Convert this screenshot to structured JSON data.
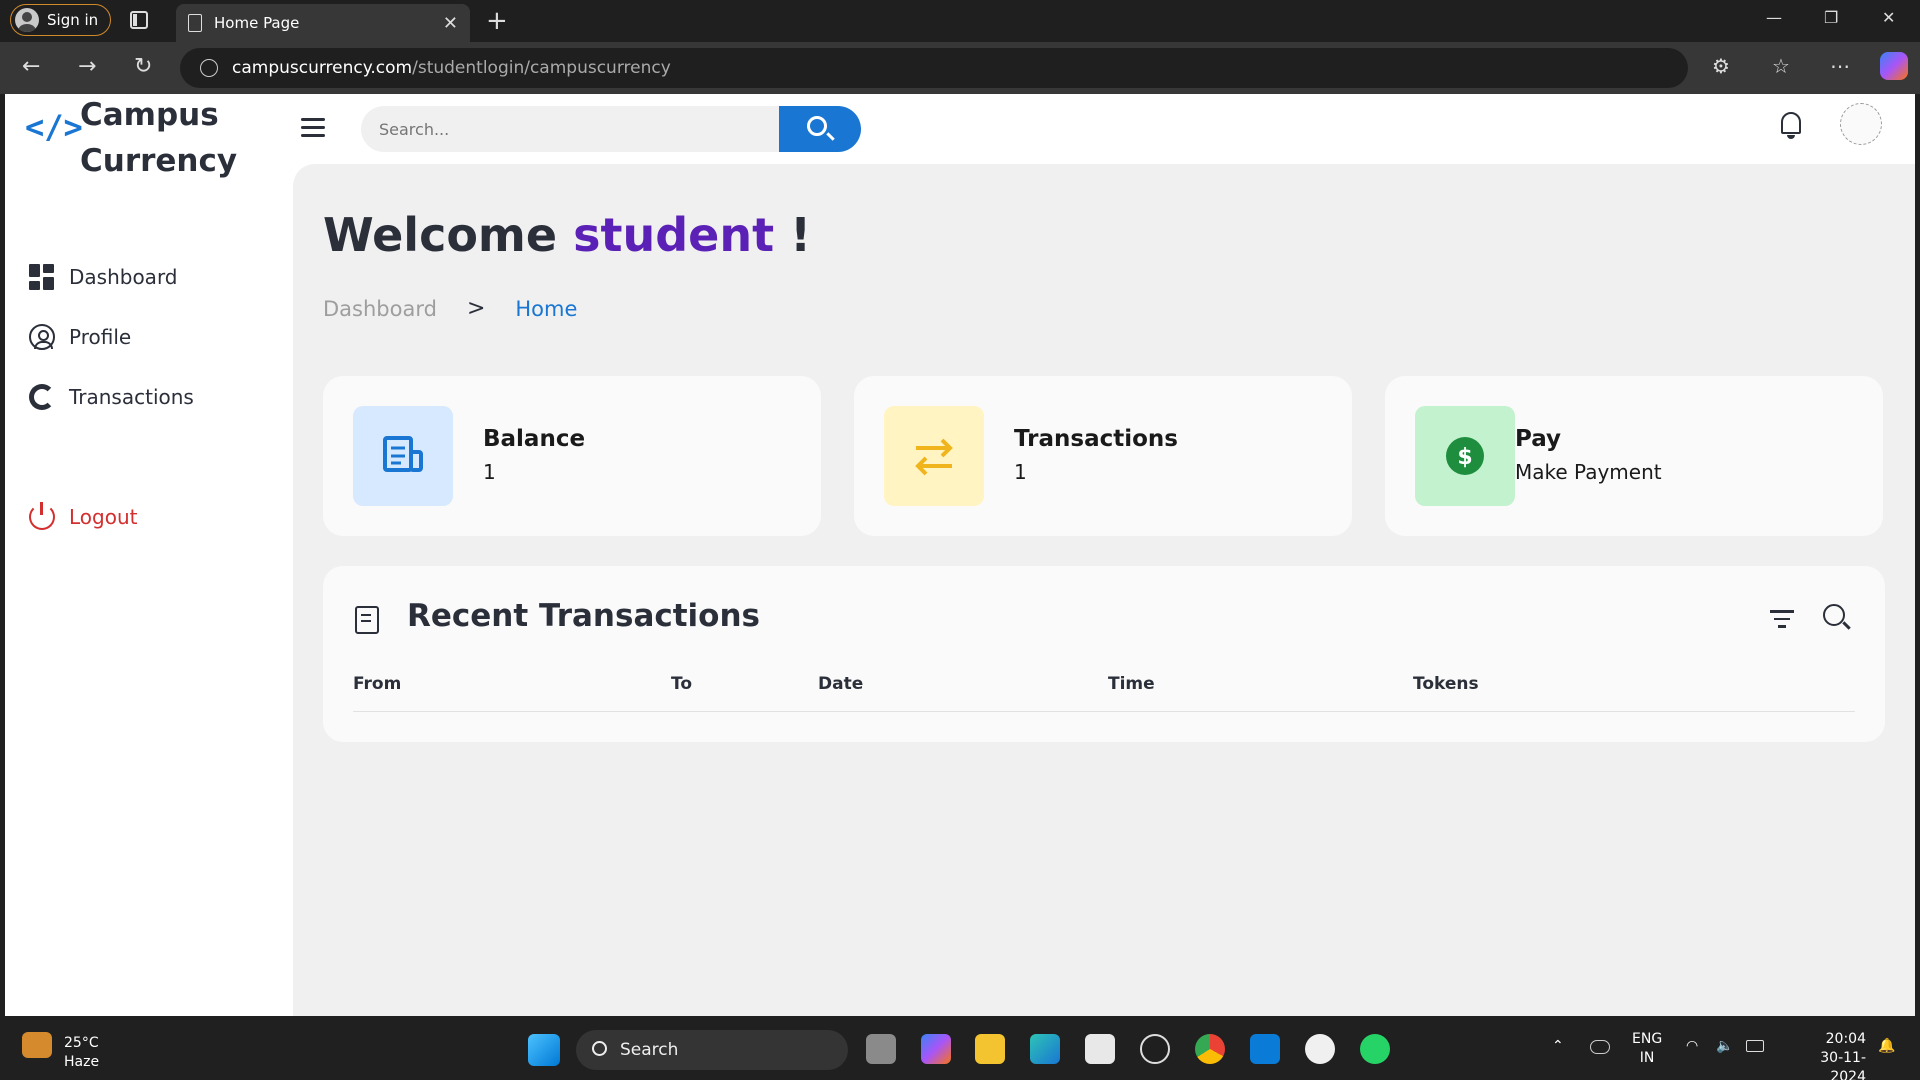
{
  "browser": {
    "signin_label": "Sign in",
    "tab_title": "Home Page",
    "url_host": "campuscurrency.com",
    "url_path": "/studentlogin/campuscurrency"
  },
  "app": {
    "logo_icon": "</>",
    "logo_line1": "Campus",
    "logo_line2": "Currency",
    "search_placeholder": "Search..."
  },
  "sidebar": {
    "items": [
      {
        "label": "Dashboard",
        "icon": "dashboard-icon"
      },
      {
        "label": "Profile",
        "icon": "profile-icon"
      },
      {
        "label": "Transactions",
        "icon": "transactions-icon"
      }
    ],
    "logout_label": "Logout"
  },
  "main": {
    "welcome_prefix": "Welcome",
    "welcome_user": "student",
    "welcome_suffix": "!",
    "breadcrumb": {
      "first": "Dashboard",
      "separator": ">",
      "current": "Home"
    },
    "cards": [
      {
        "title": "Balance",
        "value": "1",
        "icon": "receipt-icon",
        "tile_color": "#d6e9ff",
        "icon_color": "#1976d2"
      },
      {
        "title": "Transactions",
        "value": "1",
        "icon": "swap-arrows-icon",
        "tile_color": "#fff4c2",
        "icon_color": "#f0b41c"
      },
      {
        "title": "Pay",
        "value": "Make Payment",
        "icon": "dollar-icon",
        "tile_color": "#c3f2cf",
        "icon_color": "#1e8e3e"
      }
    ],
    "recent": {
      "title": "Recent Transactions",
      "columns": [
        "From",
        "To",
        "Date",
        "Time",
        "Tokens"
      ]
    }
  },
  "taskbar": {
    "temperature": "25°C",
    "weather": "Haze",
    "search_label": "Search",
    "lang_line1": "ENG",
    "lang_line2": "IN",
    "time": "20:04",
    "date": "30-11-2024"
  },
  "colors": {
    "accent": "#1976d2",
    "welcome_user": "#5b21b6",
    "logout": "#d32f2f"
  }
}
